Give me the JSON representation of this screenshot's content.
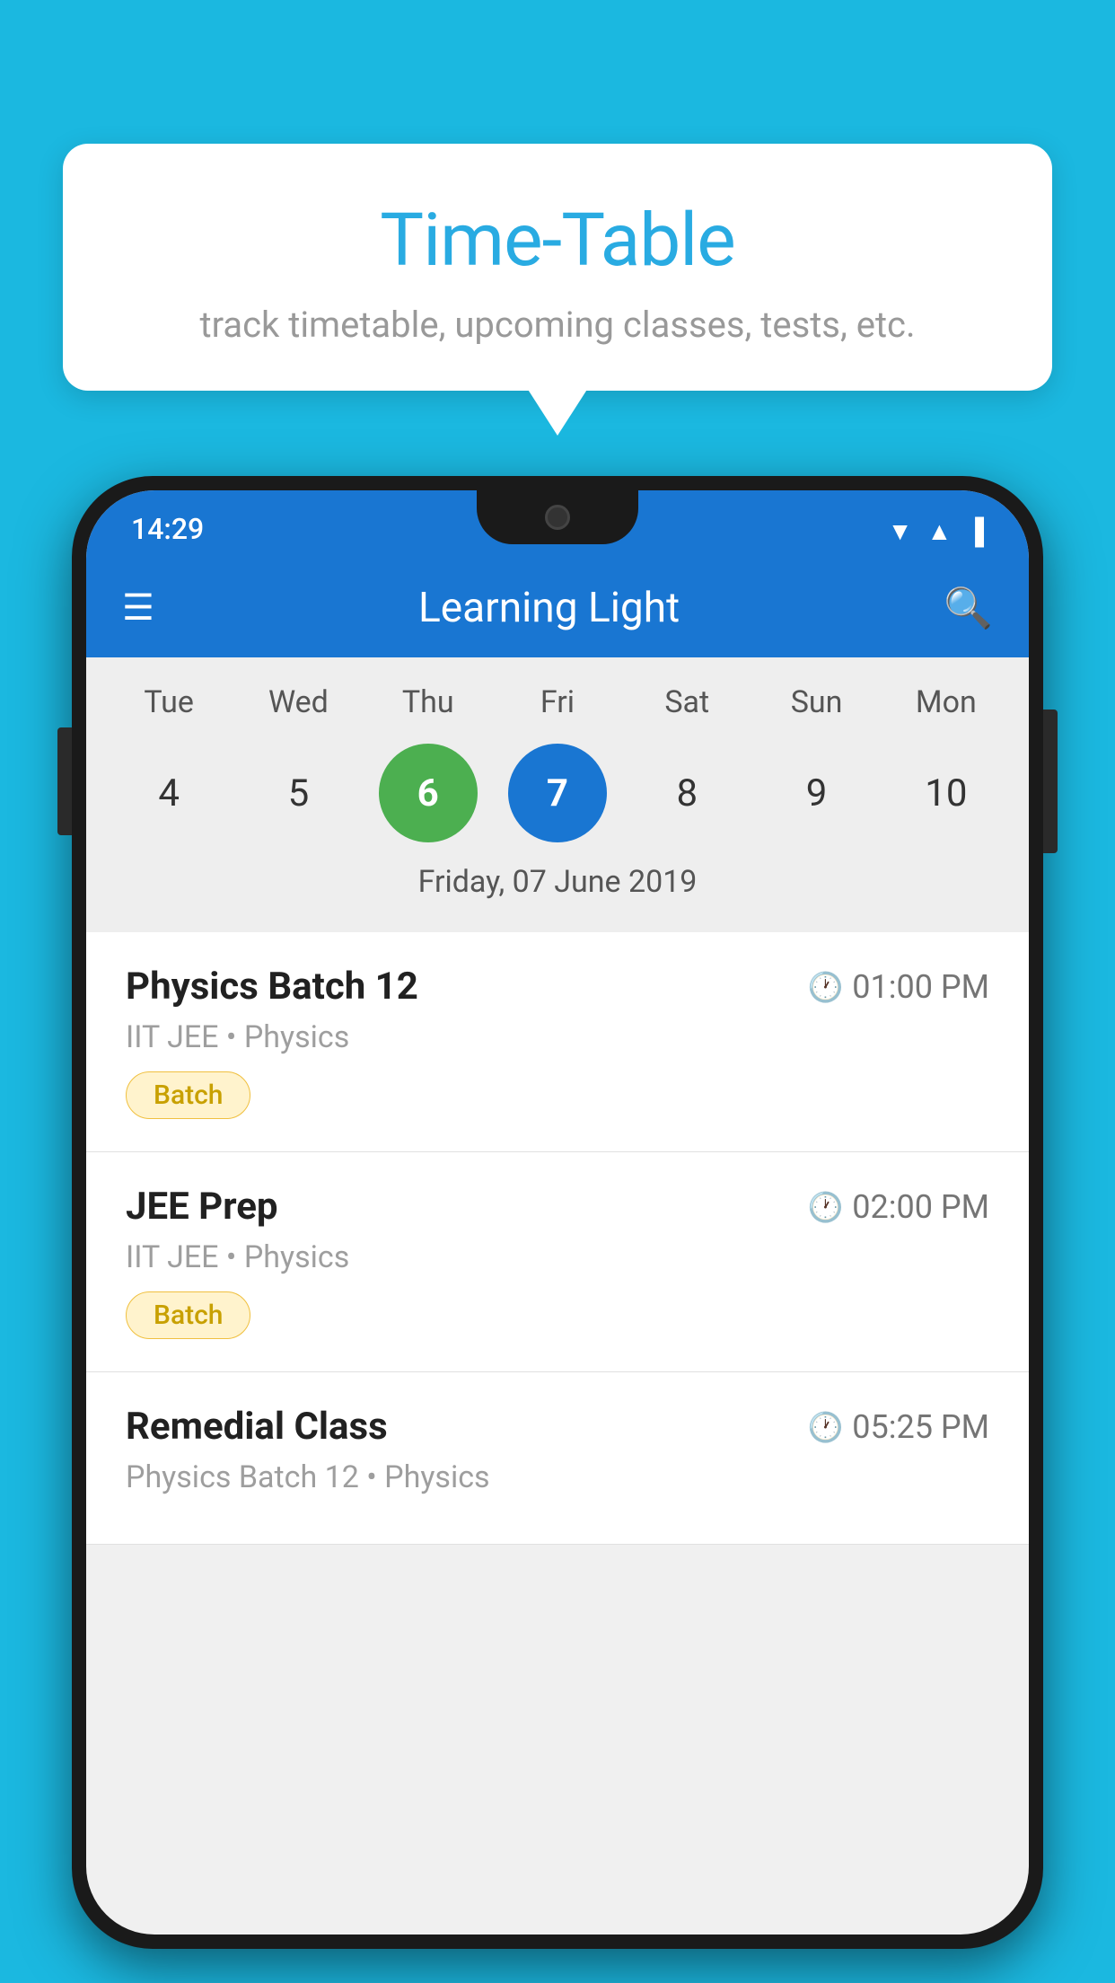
{
  "background_color": "#1BB8E0",
  "speech_bubble": {
    "title": "Time-Table",
    "subtitle": "track timetable, upcoming classes, tests, etc."
  },
  "phone": {
    "status_bar": {
      "time": "14:29"
    },
    "toolbar": {
      "title": "Learning Light",
      "hamburger_label": "☰",
      "search_label": "🔍"
    },
    "calendar": {
      "days": [
        "Tue",
        "Wed",
        "Thu",
        "Fri",
        "Sat",
        "Sun",
        "Mon"
      ],
      "dates": [
        4,
        5,
        6,
        7,
        8,
        9,
        10
      ],
      "today_index": 2,
      "selected_index": 3,
      "selected_date_label": "Friday, 07 June 2019"
    },
    "events": [
      {
        "title": "Physics Batch 12",
        "time": "01:00 PM",
        "subtitle": "IIT JEE • Physics",
        "badge": "Batch"
      },
      {
        "title": "JEE Prep",
        "time": "02:00 PM",
        "subtitle": "IIT JEE • Physics",
        "badge": "Batch"
      },
      {
        "title": "Remedial Class",
        "time": "05:25 PM",
        "subtitle": "Physics Batch 12 • Physics",
        "badge": null
      }
    ]
  }
}
